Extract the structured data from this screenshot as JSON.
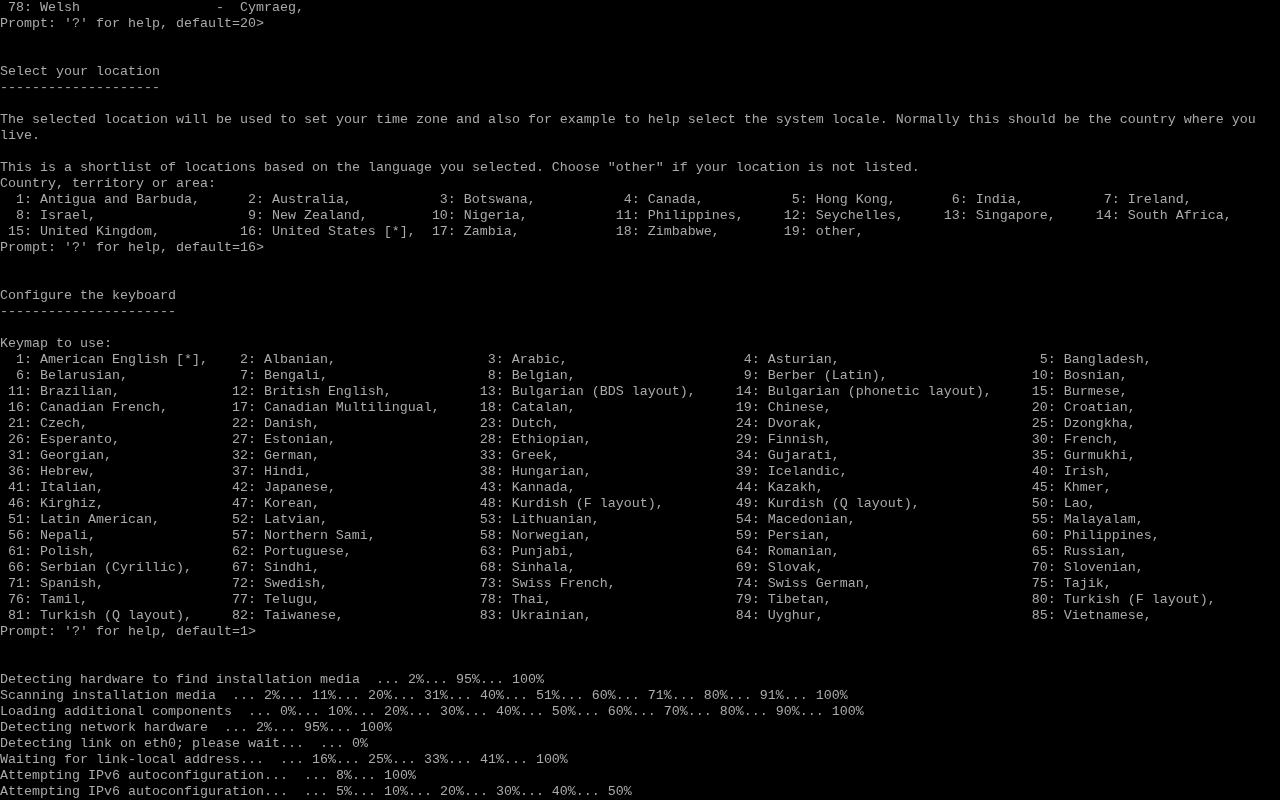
{
  "previous_question": {
    "options": [
      {
        "number": "78:",
        "label": "Welsh",
        "native": "-  Cymraeg,"
      }
    ],
    "prompt": "Prompt: '?' for help, default=20>"
  },
  "sections": [
    {
      "kind": "location",
      "title": "Select your location",
      "underline": "--------------------",
      "description": [
        "The selected location will be used to set your time zone and also for example to help select the system locale. Normally this should be the country where you live.",
        "This is a shortlist of locations based on the language you selected. Choose \"other\" if your location is not listed."
      ],
      "question": "Country, territory or area:",
      "options": [
        {
          "number": "1:",
          "label": "Antigua and Barbuda,"
        },
        {
          "number": "2:",
          "label": "Australia,"
        },
        {
          "number": "3:",
          "label": "Botswana,"
        },
        {
          "number": "4:",
          "label": "Canada,"
        },
        {
          "number": "5:",
          "label": "Hong Kong,"
        },
        {
          "number": "6:",
          "label": "India,"
        },
        {
          "number": "7:",
          "label": "Ireland,"
        },
        {
          "number": "8:",
          "label": "Israel,"
        },
        {
          "number": "9:",
          "label": "New Zealand,"
        },
        {
          "number": "10:",
          "label": "Nigeria,"
        },
        {
          "number": "11:",
          "label": "Philippines,"
        },
        {
          "number": "12:",
          "label": "Seychelles,"
        },
        {
          "number": "13:",
          "label": "Singapore,"
        },
        {
          "number": "14:",
          "label": "South Africa,"
        },
        {
          "number": "15:",
          "label": "United Kingdom,"
        },
        {
          "number": "16:",
          "label": "United States [*],"
        },
        {
          "number": "17:",
          "label": "Zambia,"
        },
        {
          "number": "18:",
          "label": "Zimbabwe,"
        },
        {
          "number": "19:",
          "label": "other,"
        }
      ],
      "prompt": "Prompt: '?' for help, default=16>"
    },
    {
      "kind": "keyboard",
      "title": "Configure the keyboard",
      "underline": "----------------------",
      "question": "Keymap to use:",
      "options": [
        {
          "number": "1:",
          "label": "American English [*],"
        },
        {
          "number": "2:",
          "label": "Albanian,"
        },
        {
          "number": "3:",
          "label": "Arabic,"
        },
        {
          "number": "4:",
          "label": "Asturian,"
        },
        {
          "number": "5:",
          "label": "Bangladesh,"
        },
        {
          "number": "6:",
          "label": "Belarusian,"
        },
        {
          "number": "7:",
          "label": "Bengali,"
        },
        {
          "number": "8:",
          "label": "Belgian,"
        },
        {
          "number": "9:",
          "label": "Berber (Latin),"
        },
        {
          "number": "10:",
          "label": "Bosnian,"
        },
        {
          "number": "11:",
          "label": "Brazilian,"
        },
        {
          "number": "12:",
          "label": "British English,"
        },
        {
          "number": "13:",
          "label": "Bulgarian (BDS layout),"
        },
        {
          "number": "14:",
          "label": "Bulgarian (phonetic layout),"
        },
        {
          "number": "15:",
          "label": "Burmese,"
        },
        {
          "number": "16:",
          "label": "Canadian French,"
        },
        {
          "number": "17:",
          "label": "Canadian Multilingual,"
        },
        {
          "number": "18:",
          "label": "Catalan,"
        },
        {
          "number": "19:",
          "label": "Chinese,"
        },
        {
          "number": "20:",
          "label": "Croatian,"
        },
        {
          "number": "21:",
          "label": "Czech,"
        },
        {
          "number": "22:",
          "label": "Danish,"
        },
        {
          "number": "23:",
          "label": "Dutch,"
        },
        {
          "number": "24:",
          "label": "Dvorak,"
        },
        {
          "number": "25:",
          "label": "Dzongkha,"
        },
        {
          "number": "26:",
          "label": "Esperanto,"
        },
        {
          "number": "27:",
          "label": "Estonian,"
        },
        {
          "number": "28:",
          "label": "Ethiopian,"
        },
        {
          "number": "29:",
          "label": "Finnish,"
        },
        {
          "number": "30:",
          "label": "French,"
        },
        {
          "number": "31:",
          "label": "Georgian,"
        },
        {
          "number": "32:",
          "label": "German,"
        },
        {
          "number": "33:",
          "label": "Greek,"
        },
        {
          "number": "34:",
          "label": "Gujarati,"
        },
        {
          "number": "35:",
          "label": "Gurmukhi,"
        },
        {
          "number": "36:",
          "label": "Hebrew,"
        },
        {
          "number": "37:",
          "label": "Hindi,"
        },
        {
          "number": "38:",
          "label": "Hungarian,"
        },
        {
          "number": "39:",
          "label": "Icelandic,"
        },
        {
          "number": "40:",
          "label": "Irish,"
        },
        {
          "number": "41:",
          "label": "Italian,"
        },
        {
          "number": "42:",
          "label": "Japanese,"
        },
        {
          "number": "43:",
          "label": "Kannada,"
        },
        {
          "number": "44:",
          "label": "Kazakh,"
        },
        {
          "number": "45:",
          "label": "Khmer,"
        },
        {
          "number": "46:",
          "label": "Kirghiz,"
        },
        {
          "number": "47:",
          "label": "Korean,"
        },
        {
          "number": "48:",
          "label": "Kurdish (F layout),"
        },
        {
          "number": "49:",
          "label": "Kurdish (Q layout),"
        },
        {
          "number": "50:",
          "label": "Lao,"
        },
        {
          "number": "51:",
          "label": "Latin American,"
        },
        {
          "number": "52:",
          "label": "Latvian,"
        },
        {
          "number": "53:",
          "label": "Lithuanian,"
        },
        {
          "number": "54:",
          "label": "Macedonian,"
        },
        {
          "number": "55:",
          "label": "Malayalam,"
        },
        {
          "number": "56:",
          "label": "Nepali,"
        },
        {
          "number": "57:",
          "label": "Northern Sami,"
        },
        {
          "number": "58:",
          "label": "Norwegian,"
        },
        {
          "number": "59:",
          "label": "Persian,"
        },
        {
          "number": "60:",
          "label": "Philippines,"
        },
        {
          "number": "61:",
          "label": "Polish,"
        },
        {
          "number": "62:",
          "label": "Portuguese,"
        },
        {
          "number": "63:",
          "label": "Punjabi,"
        },
        {
          "number": "64:",
          "label": "Romanian,"
        },
        {
          "number": "65:",
          "label": "Russian,"
        },
        {
          "number": "66:",
          "label": "Serbian (Cyrillic),"
        },
        {
          "number": "67:",
          "label": "Sindhi,"
        },
        {
          "number": "68:",
          "label": "Sinhala,"
        },
        {
          "number": "69:",
          "label": "Slovak,"
        },
        {
          "number": "70:",
          "label": "Slovenian,"
        },
        {
          "number": "71:",
          "label": "Spanish,"
        },
        {
          "number": "72:",
          "label": "Swedish,"
        },
        {
          "number": "73:",
          "label": "Swiss French,"
        },
        {
          "number": "74:",
          "label": "Swiss German,"
        },
        {
          "number": "75:",
          "label": "Tajik,"
        },
        {
          "number": "76:",
          "label": "Tamil,"
        },
        {
          "number": "77:",
          "label": "Telugu,"
        },
        {
          "number": "78:",
          "label": "Thai,"
        },
        {
          "number": "79:",
          "label": "Tibetan,"
        },
        {
          "number": "80:",
          "label": "Turkish (F layout),"
        },
        {
          "number": "81:",
          "label": "Turkish (Q layout),"
        },
        {
          "number": "82:",
          "label": "Taiwanese,"
        },
        {
          "number": "83:",
          "label": "Ukrainian,"
        },
        {
          "number": "84:",
          "label": "Uyghur,"
        },
        {
          "number": "85:",
          "label": "Vietnamese,"
        }
      ],
      "prompt": "Prompt: '?' for help, default=1>"
    }
  ],
  "log": [
    "Detecting hardware to find installation media  ... 2%... 95%... 100%",
    "Scanning installation media  ... 2%... 11%... 20%... 31%... 40%... 51%... 60%... 71%... 80%... 91%... 100%",
    "Loading additional components  ... 0%... 10%... 20%... 30%... 40%... 50%... 60%... 70%... 80%... 90%... 100%",
    "Detecting network hardware  ... 2%... 95%... 100%",
    "Detecting link on eth0; please wait...  ... 0%",
    "Waiting for link-local address...  ... 16%... 25%... 33%... 41%... 100%",
    "Attempting IPv6 autoconfiguration...  ... 8%... 100%",
    "Attempting IPv6 autoconfiguration...  ... 5%... 10%... 20%... 30%... 40%... 50%"
  ]
}
